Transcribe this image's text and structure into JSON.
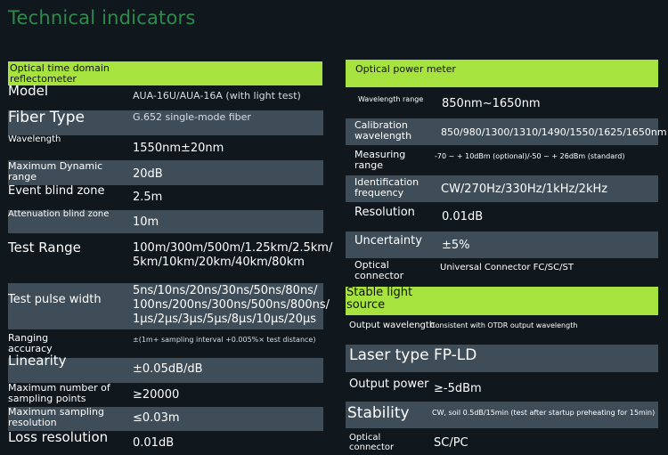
{
  "title": "Technical indicators",
  "otdr": {
    "header": "Optical time domain reflectometer",
    "rows": [
      {
        "label": "Model",
        "value": "AUA-16U/AUA-16A (with light test)"
      },
      {
        "label": "Fiber Type",
        "value": "G.652 single-mode fiber"
      },
      {
        "label": "Wavelength",
        "value": "1550nm±20nm"
      },
      {
        "label": "Maximum Dynamic range",
        "value": "20dB"
      },
      {
        "label": "Event blind zone",
        "value": "2.5m"
      },
      {
        "label": "Attenuation blind zone",
        "value": "10m"
      },
      {
        "label": "Test Range",
        "value_lines": [
          "100m/300m/500m/1.25km/2.5km/",
          "5km/10km/20km/40km/80km"
        ]
      },
      {
        "label": "Test pulse width",
        "value_lines": [
          "5ns/10ns/20ns/30ns/50ns/80ns/",
          "100ns/200ns/300ns/500ns/800ns/",
          "1μs/2μs/3μs/5μs/8μs/10μs/20μs"
        ]
      },
      {
        "label": "Ranging accuracy",
        "value": "±(1m+ sampling interval +0.005%× test distance)"
      },
      {
        "label": "Linearity",
        "value": "±0.05dB/dB"
      },
      {
        "label": "Maximum number of sampling points",
        "value": "≥20000"
      },
      {
        "label": "Maximum sampling resolution",
        "value": "≤0.03m"
      },
      {
        "label": "Loss resolution",
        "value": "0.01dB"
      }
    ]
  },
  "power_meter": {
    "header": "Optical power meter",
    "rows": [
      {
        "label": "Wavelength range",
        "value": "850nm~1650nm"
      },
      {
        "label": "Calibration wavelength",
        "value": "850/980/1300/1310/1490/1550/1625/1650nm"
      },
      {
        "label": "Measuring range",
        "value": "-70 ~ + 10dBm (optional)/-50 ~ + 26dBm (standard)"
      },
      {
        "label": "Identification frequency",
        "value": "CW/270Hz/330Hz/1kHz/2kHz"
      },
      {
        "label": "Resolution",
        "value": "0.01dB"
      },
      {
        "label": "Uncertainty",
        "value": "±5%"
      },
      {
        "label": "Optical connector",
        "value": "Universal Connector FC/SC/ST"
      }
    ]
  },
  "light_source": {
    "header": "Stable light source",
    "rows": [
      {
        "label": "Output wavelength",
        "value": "Consistent with OTDR output wavelength"
      },
      {
        "label": "Laser type FP-LD",
        "value": ""
      },
      {
        "label": "Output power",
        "value": "≥-5dBm"
      },
      {
        "label": "Stability",
        "value": "CW, soil 0.5dB/15min (test after startup preheating for 15min)"
      },
      {
        "label": "Optical connector",
        "value": "SC/PC"
      }
    ]
  },
  "colors": {
    "accent": "#a7e33f",
    "band": "#3e4d58",
    "background": "#10171d",
    "title": "#2f8a4d"
  }
}
